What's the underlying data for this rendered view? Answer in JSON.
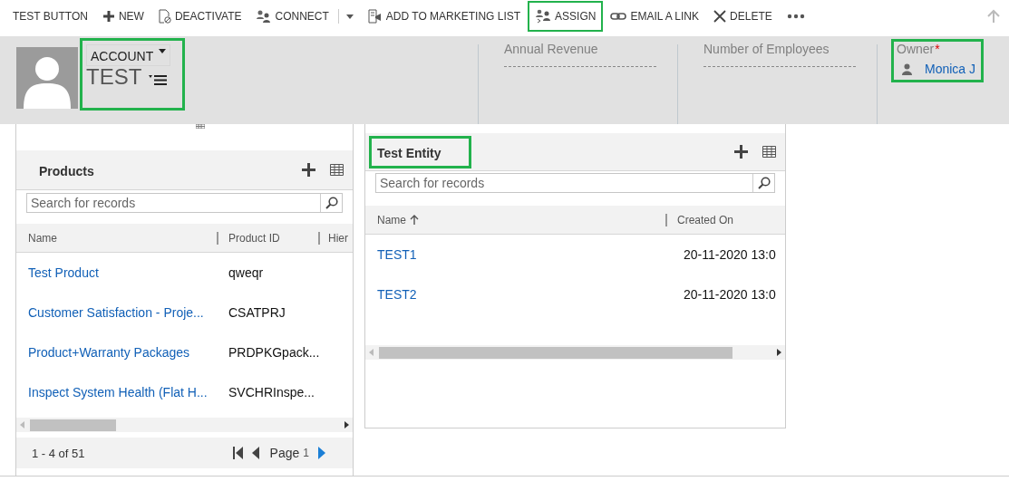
{
  "toolbar": {
    "items": [
      {
        "kind": "command",
        "label": "TEST BUTTON",
        "highlighted": false
      },
      {
        "kind": "command",
        "label": "NEW",
        "highlighted": false
      },
      {
        "kind": "command",
        "label": "DEACTIVATE",
        "highlighted": false
      },
      {
        "kind": "command",
        "label": "CONNECT",
        "highlighted": false
      },
      {
        "kind": "dropdown",
        "highlighted": false
      },
      {
        "kind": "command",
        "label": "ADD TO MARKETING LIST",
        "highlighted": false
      },
      {
        "kind": "command",
        "label": "ASSIGN",
        "highlighted": true
      },
      {
        "kind": "command",
        "label": "EMAIL A LINK",
        "highlighted": false
      },
      {
        "kind": "command",
        "label": "DELETE",
        "highlighted": false
      },
      {
        "kind": "overflow",
        "highlighted": false
      }
    ]
  },
  "header": {
    "entity_type": "ACCOUNT",
    "record_name": "TEST",
    "highlighted": true,
    "fields": [
      {
        "label": "Annual Revenue",
        "highlighted": false
      },
      {
        "label": "Number of Employees",
        "highlighted": false
      },
      {
        "label": "Owner",
        "value": "Monica J",
        "required_mark": "*",
        "highlighted": true
      }
    ]
  },
  "subgrids": [
    {
      "title": "Products",
      "highlighted": false,
      "search": {
        "placeholder": "Search for records"
      },
      "columns": [
        {
          "label": "Name",
          "sorted": false
        },
        {
          "label": "Product ID",
          "sorted": false
        },
        {
          "label": "Hier",
          "sorted": false
        }
      ],
      "rows": [
        [
          "Test Product",
          "qweqr"
        ],
        [
          "Customer Satisfaction - Proje...",
          "CSATPRJ"
        ],
        [
          "Product+Warranty Packages",
          "PRDPKGpack..."
        ],
        [
          "Inspect System Health (Flat H...",
          "SVCHRInspe..."
        ]
      ],
      "footer": {
        "count": "1 - 4 of 51",
        "page_label": "Page",
        "page": "1"
      }
    },
    {
      "title": "Test Entity",
      "highlighted": true,
      "search": {
        "placeholder": "Search for records"
      },
      "columns": [
        {
          "label": "Name",
          "sorted": true
        },
        {
          "label": "Created On",
          "sorted": false
        }
      ],
      "rows": [
        [
          "TEST1",
          "20-11-2020 13:0"
        ],
        [
          "TEST2",
          "20-11-2020 13:0"
        ]
      ]
    }
  ]
}
